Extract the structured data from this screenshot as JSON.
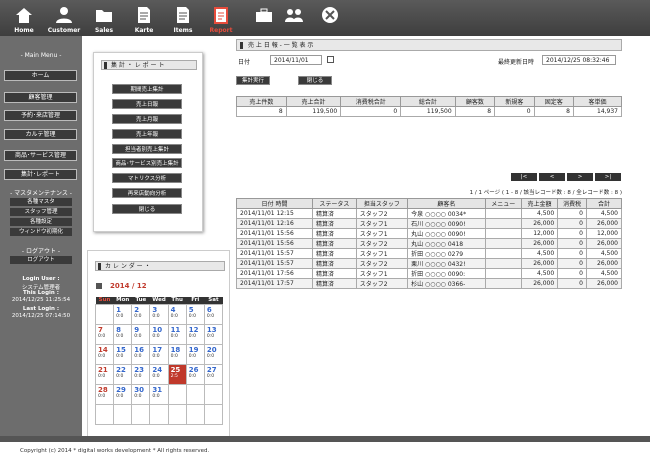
{
  "nav": [
    {
      "label": "Home",
      "icon": "home-icon"
    },
    {
      "label": "Customer",
      "icon": "customer-icon"
    },
    {
      "label": "Sales",
      "icon": "sales-folder-icon"
    },
    {
      "label": "Karte",
      "icon": "karte-document-icon"
    },
    {
      "label": "Items",
      "icon": "items-document-icon"
    },
    {
      "label": "Report",
      "icon": "report-clipboard-icon"
    },
    {
      "label": "",
      "icon": "toolbox-icon"
    },
    {
      "label": "",
      "icon": "group-icon"
    },
    {
      "label": "",
      "icon": "close-circle-icon"
    }
  ],
  "sidebar": {
    "main_menu": "- Main Menu -",
    "items": [
      "ホーム",
      "顧客管理",
      "予約･来店管理",
      "カルテ管理",
      "商品･サービス管理",
      "集計･レポート"
    ],
    "master_head": "- マスタメンテナンス -",
    "master_items": [
      "各種マスタ",
      "スタッフ管理",
      "各種設定",
      "ウィンドウ初期化"
    ],
    "logout_head": "- ログアウト -",
    "logout": "ログアウト",
    "login_user_label": "Login User :",
    "login_user": "システム管理者",
    "this_login_label": "This Login :",
    "this_login": "2014/12/25 11:25:54",
    "last_login_label": "Last Login :",
    "last_login": "2014/12/25 07:14:50"
  },
  "report_panel": {
    "title": "集 計 ・ レ ポ ー ト",
    "buttons": [
      "期間売上集計",
      "売上日報",
      "売上月報",
      "売上年報",
      "担当者別売上集計",
      "商品･サービス別売上集計",
      "マトリクス分析",
      "再来店動向分析",
      "閉じる"
    ]
  },
  "calendar": {
    "title": "カ レ ン ダ ー ・",
    "month": "2014 / 12",
    "weekdays": [
      "Sun",
      "Mon",
      "Tue",
      "Wed",
      "Thu",
      "Fri",
      "Sat"
    ],
    "weeks": [
      [
        {
          "d": "",
          "s": ""
        },
        {
          "d": "1",
          "s": "0:0"
        },
        {
          "d": "2",
          "s": "0:0"
        },
        {
          "d": "3",
          "s": "0:0"
        },
        {
          "d": "4",
          "s": "0:0"
        },
        {
          "d": "5",
          "s": "0:0"
        },
        {
          "d": "6",
          "s": "0:0"
        }
      ],
      [
        {
          "d": "7",
          "s": "0:0"
        },
        {
          "d": "8",
          "s": "0:0"
        },
        {
          "d": "9",
          "s": "0:0"
        },
        {
          "d": "10",
          "s": "0:0"
        },
        {
          "d": "11",
          "s": "0:0"
        },
        {
          "d": "12",
          "s": "0:0"
        },
        {
          "d": "13",
          "s": "0:0"
        }
      ],
      [
        {
          "d": "14",
          "s": "0:0"
        },
        {
          "d": "15",
          "s": "0:0"
        },
        {
          "d": "16",
          "s": "0:0"
        },
        {
          "d": "17",
          "s": "0:0"
        },
        {
          "d": "18",
          "s": "0:0"
        },
        {
          "d": "19",
          "s": "0:0"
        },
        {
          "d": "20",
          "s": "0:0"
        }
      ],
      [
        {
          "d": "21",
          "s": "0:0"
        },
        {
          "d": "22",
          "s": "0:0"
        },
        {
          "d": "23",
          "s": "0:0"
        },
        {
          "d": "24",
          "s": "0:0"
        },
        {
          "d": "25",
          "s": "2:5"
        },
        {
          "d": "26",
          "s": "0:0"
        },
        {
          "d": "27",
          "s": "0:0"
        }
      ],
      [
        {
          "d": "28",
          "s": "0:0"
        },
        {
          "d": "29",
          "s": "0:0"
        },
        {
          "d": "30",
          "s": "0:0"
        },
        {
          "d": "31",
          "s": "0:0"
        },
        {
          "d": "",
          "s": ""
        },
        {
          "d": "",
          "s": ""
        },
        {
          "d": "",
          "s": ""
        }
      ],
      [
        {
          "d": "",
          "s": ""
        },
        {
          "d": "",
          "s": ""
        },
        {
          "d": "",
          "s": ""
        },
        {
          "d": "",
          "s": ""
        },
        {
          "d": "",
          "s": ""
        },
        {
          "d": "",
          "s": ""
        },
        {
          "d": "",
          "s": ""
        }
      ]
    ]
  },
  "main": {
    "title": "売 上 日 報 - 一 覧 表 示",
    "date_label": "日付",
    "date_value": "2014/11/01",
    "updated_label": "最終更新日時",
    "updated_value": "2014/12/25 08:32:46",
    "run_button": "集計実行",
    "close_button": "閉じる",
    "summary_headers": [
      "売上件数",
      "売上合計",
      "消費税合計",
      "総合計",
      "顧客数",
      "新規客",
      "固定客",
      "客単価"
    ],
    "summary_values": [
      "8",
      "119,500",
      "0",
      "119,500",
      "8",
      "0",
      "8",
      "14,937"
    ],
    "pager": [
      "|<",
      "<",
      ">",
      ">|"
    ],
    "page_info": "1 / 1 ページ ( 1 - 8 / 該当レコード数 : 8 / 全レコード数 : 8 )",
    "list_headers": [
      "日付 時間",
      "ステータス",
      "担当スタッフ",
      "顧客名",
      "メニュー",
      "売上金額",
      "消費税",
      "合計"
    ],
    "rows": [
      [
        "2014/11/01 12:15",
        "精算済",
        "スタッフ2",
        "今泉 ○○○○ 0034*",
        "",
        "4,500",
        "0",
        "4,500"
      ],
      [
        "2014/11/01 12:16",
        "精算済",
        "スタッフ1",
        "石川 ○○○○ 0090!",
        "",
        "26,000",
        "0",
        "26,000"
      ],
      [
        "2014/11/01 15:56",
        "精算済",
        "スタッフ1",
        "丸山 ○○○○ 0090!",
        "",
        "12,000",
        "0",
        "12,000"
      ],
      [
        "2014/11/01 15:56",
        "精算済",
        "スタッフ2",
        "丸山 ○○○○ 0418",
        "",
        "26,000",
        "0",
        "26,000"
      ],
      [
        "2014/11/01 15:57",
        "精算済",
        "スタッフ1",
        "折田 ○○○○ 0279",
        "",
        "4,500",
        "0",
        "4,500"
      ],
      [
        "2014/11/01 15:57",
        "精算済",
        "スタッフ2",
        "栗川 ○○○○ 0432!",
        "",
        "26,000",
        "0",
        "26,000"
      ],
      [
        "2014/11/01 17:56",
        "精算済",
        "スタッフ1",
        "折田 ○○○○ 0090:",
        "",
        "4,500",
        "0",
        "4,500"
      ],
      [
        "2014/11/01 17:57",
        "精算済",
        "スタッフ2",
        "杉山 ○○○○ 0366-",
        "",
        "26,000",
        "0",
        "26,000"
      ]
    ]
  },
  "footer": "Copyright (c) 2014 * digital works development * All rights reserved.",
  "colors": {
    "accent_red": "#c0392b",
    "nav_active": "#e74c3c",
    "dark": "#3a3a3a"
  }
}
